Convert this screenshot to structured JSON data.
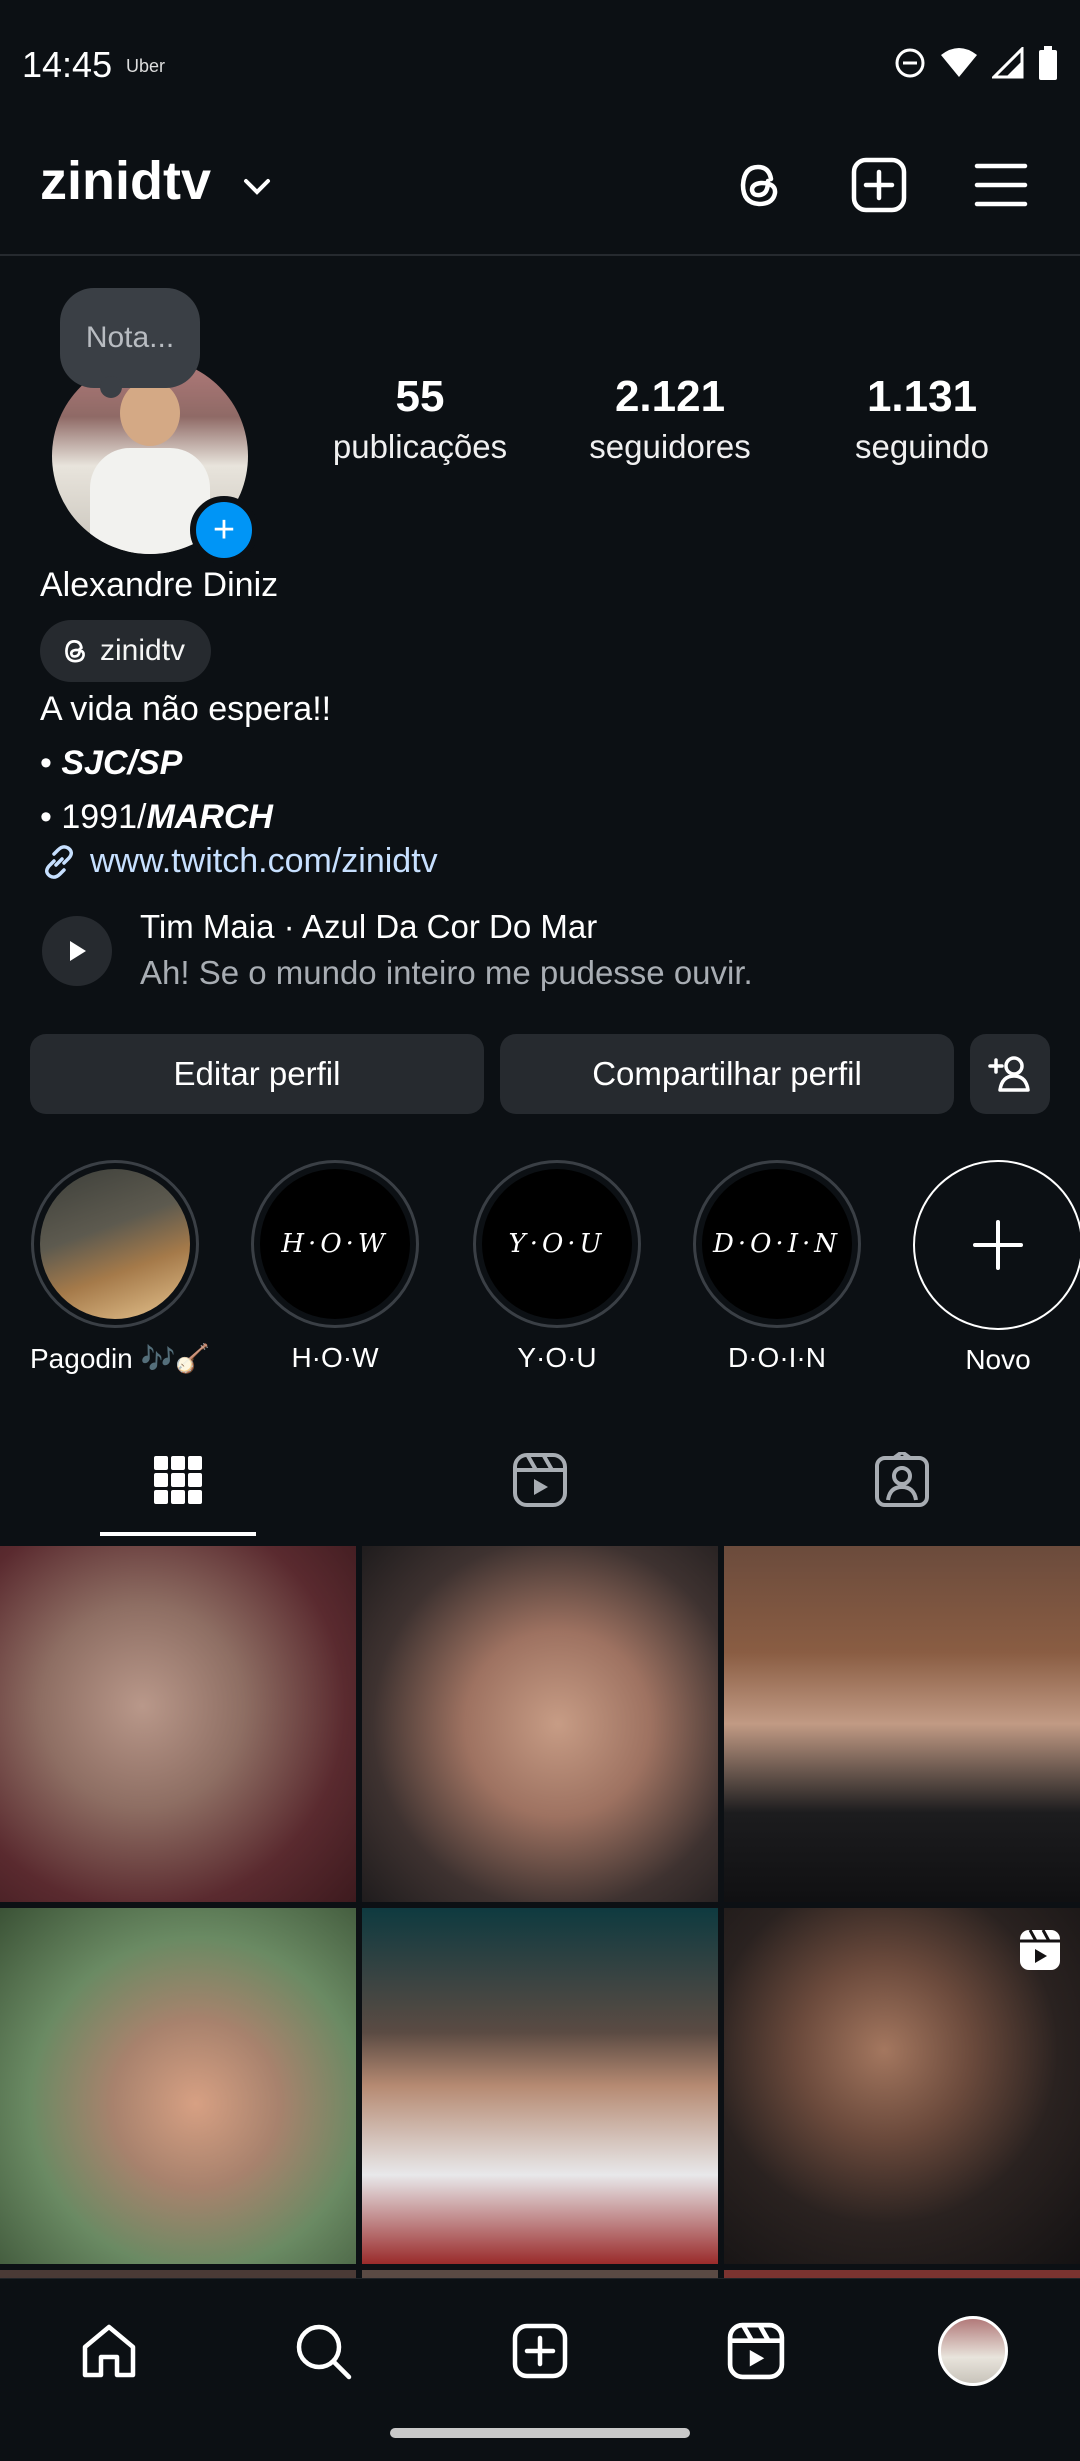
{
  "status": {
    "time": "14:45",
    "app": "Uber"
  },
  "header": {
    "username": "zinidtv"
  },
  "note": {
    "placeholder": "Nota..."
  },
  "stats": [
    {
      "num": "55",
      "label": "publicações"
    },
    {
      "num": "2.121",
      "label": "seguidores"
    },
    {
      "num": "1.131",
      "label": "seguindo"
    }
  ],
  "bio": {
    "name": "Alexandre Diniz",
    "threads_handle": "zinidtv",
    "line1": "A vida não espera!!",
    "line2_prefix": "• ",
    "line2_bold": "SJC/SP",
    "line3_prefix": "• 1991/",
    "line3_bold": "MARCH",
    "link": "www.twitch.com/zinidtv"
  },
  "music": {
    "title": "Tim Maia · Azul Da Cor Do Mar",
    "lyric": "Ah! Se o mundo inteiro me pudesse ouvir."
  },
  "buttons": {
    "edit": "Editar perfil",
    "share": "Compartilhar perfil"
  },
  "highlights": [
    {
      "label": "Pagodin 🎶🪕",
      "cover": ""
    },
    {
      "label": "H·O·W",
      "cover": "H·O·W"
    },
    {
      "label": "Y·O·U",
      "cover": "Y·O·U"
    },
    {
      "label": "D·O·I·N",
      "cover": "D·O·I·N"
    },
    {
      "label": "Novo",
      "cover": ""
    }
  ],
  "colors": {
    "background": "#0c1014",
    "accent": "#0095f6",
    "surface": "#262a2f"
  }
}
